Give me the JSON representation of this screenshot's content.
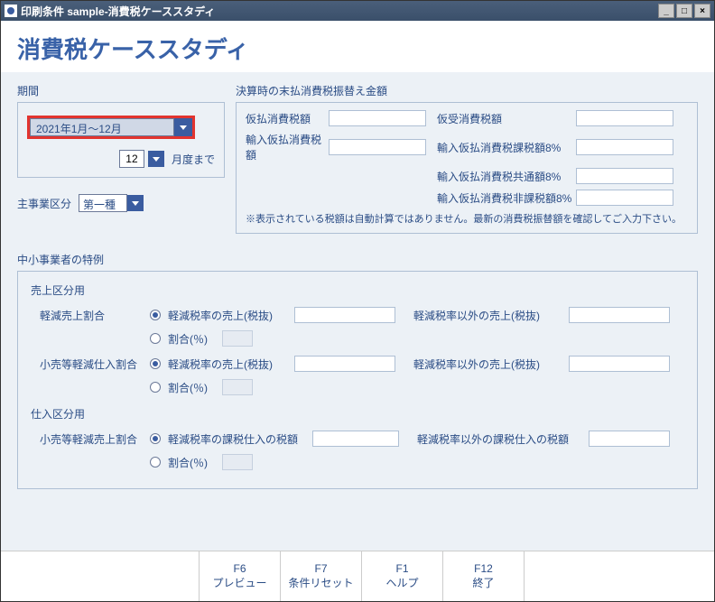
{
  "window": {
    "title": "印刷条件 sample-消費税ケーススタディ"
  },
  "page_title": "消費税ケーススタディ",
  "period": {
    "label": "期間",
    "range": "2021年1月～12月",
    "month_value": "12",
    "month_suffix": "月度まで"
  },
  "main_business": {
    "label": "主事業区分",
    "value": "第一種"
  },
  "settlement": {
    "label": "決算時の末払消費税振替え金額",
    "rows": {
      "provisional_paid": "仮払消費税額",
      "provisional_received": "仮受消費税額",
      "import_provisional": "輸入仮払消費税額",
      "import_taxable_8": "輸入仮払消費税課税額8%",
      "import_common_8": "輸入仮払消費税共通額8%",
      "import_nontaxable_8": "輸入仮払消費税非課税額8%"
    },
    "note": "※表示されている税額は自動計算ではありません。最新の消費税振替額を確認してご入力下さい。"
  },
  "special": {
    "section_label": "中小事業者の特例",
    "sales_head": "売上区分用",
    "purchase_head": "仕入区分用",
    "reduced_sales_ratio": "軽減売上割合",
    "retail_reduced_purchase_ratio": "小売等軽減仕入割合",
    "retail_reduced_sales_ratio": "小売等軽減売上割合",
    "opt_reduced_sales": "軽減税率の売上(税抜)",
    "opt_other_sales": "軽減税率以外の売上(税抜)",
    "opt_reduced_purchase_tax": "軽減税率の課税仕入の税額",
    "opt_other_purchase_tax": "軽減税率以外の課税仕入の税額",
    "opt_percent": "割合(％)"
  },
  "footer": {
    "f6_key": "F6",
    "f6_label": "プレビュー",
    "f7_key": "F7",
    "f7_label": "条件リセット",
    "f1_key": "F1",
    "f1_label": "ヘルプ",
    "f12_key": "F12",
    "f12_label": "終了"
  }
}
